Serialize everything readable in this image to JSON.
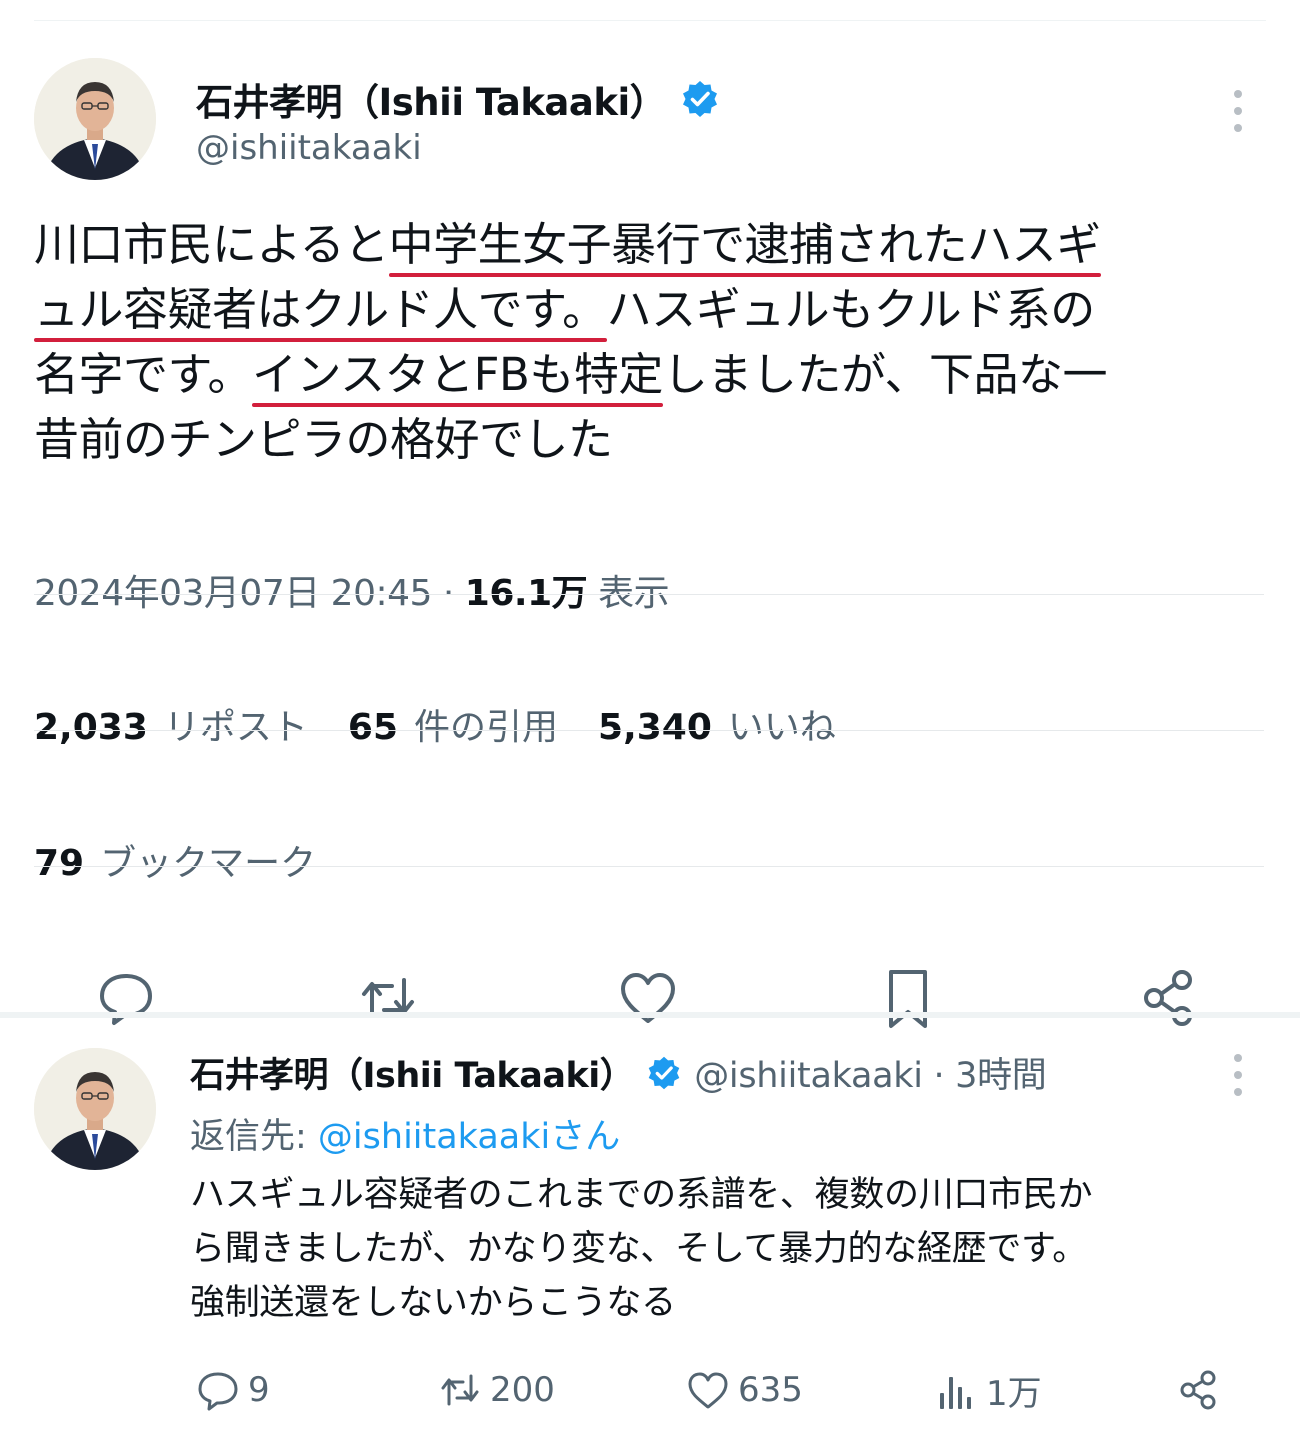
{
  "main_tweet": {
    "author_name": "石井孝明（Ishii Takaaki）",
    "handle": "@ishiitakaaki",
    "text_segments": [
      {
        "text": "川口市民によると",
        "highlight": false
      },
      {
        "text": "中学生女子暴行で逮捕されたハスギ",
        "highlight": true
      },
      {
        "text": "ュル容疑者はクルド人です。",
        "highlight": true
      },
      {
        "text": "ハスギュルもクルド系の",
        "highlight": false
      },
      {
        "text": "名字です。",
        "highlight": false
      },
      {
        "text": "インスタとFBも特定",
        "highlight": true
      },
      {
        "text": "しましたが、下品な一",
        "highlight": false
      },
      {
        "text": "昔前のチンピラの格好でした",
        "highlight": false
      }
    ],
    "timestamp": "2024年03月07日 20:45",
    "separator": "·",
    "views_count": "16.1万",
    "views_label": "表示",
    "stats": [
      {
        "count": "2,033",
        "label": "リポスト"
      },
      {
        "count": "65",
        "label": "件の引用"
      },
      {
        "count": "5,340",
        "label": "いいね"
      }
    ],
    "bookmarks": {
      "count": "79",
      "label": "ブックマーク"
    },
    "actions": [
      "reply-icon",
      "retweet-icon",
      "like-icon",
      "bookmark-icon",
      "share-icon"
    ]
  },
  "reply_tweet": {
    "author_name": "石井孝明（Ishii Takaaki）",
    "handle_time": "@ishiitakaaki · 3時間",
    "replying_prefix": "返信先: ",
    "replying_to": "@ishiitakaakiさん",
    "text_lines": [
      "ハスギュル容疑者のこれまでの系譜を、複数の川口市民か",
      "ら聞きましたが、かなり変な、そして暴力的な経歴です。",
      "強制送還をしないからこうなる"
    ],
    "actions": {
      "replies": "9",
      "retweets": "200",
      "likes": "635",
      "views": "1万"
    }
  },
  "colors": {
    "text": "#0f1419",
    "secondary": "#536471",
    "verified": "#1d9bf0",
    "underline": "#d21f3c",
    "divider": "#eff3f4"
  }
}
